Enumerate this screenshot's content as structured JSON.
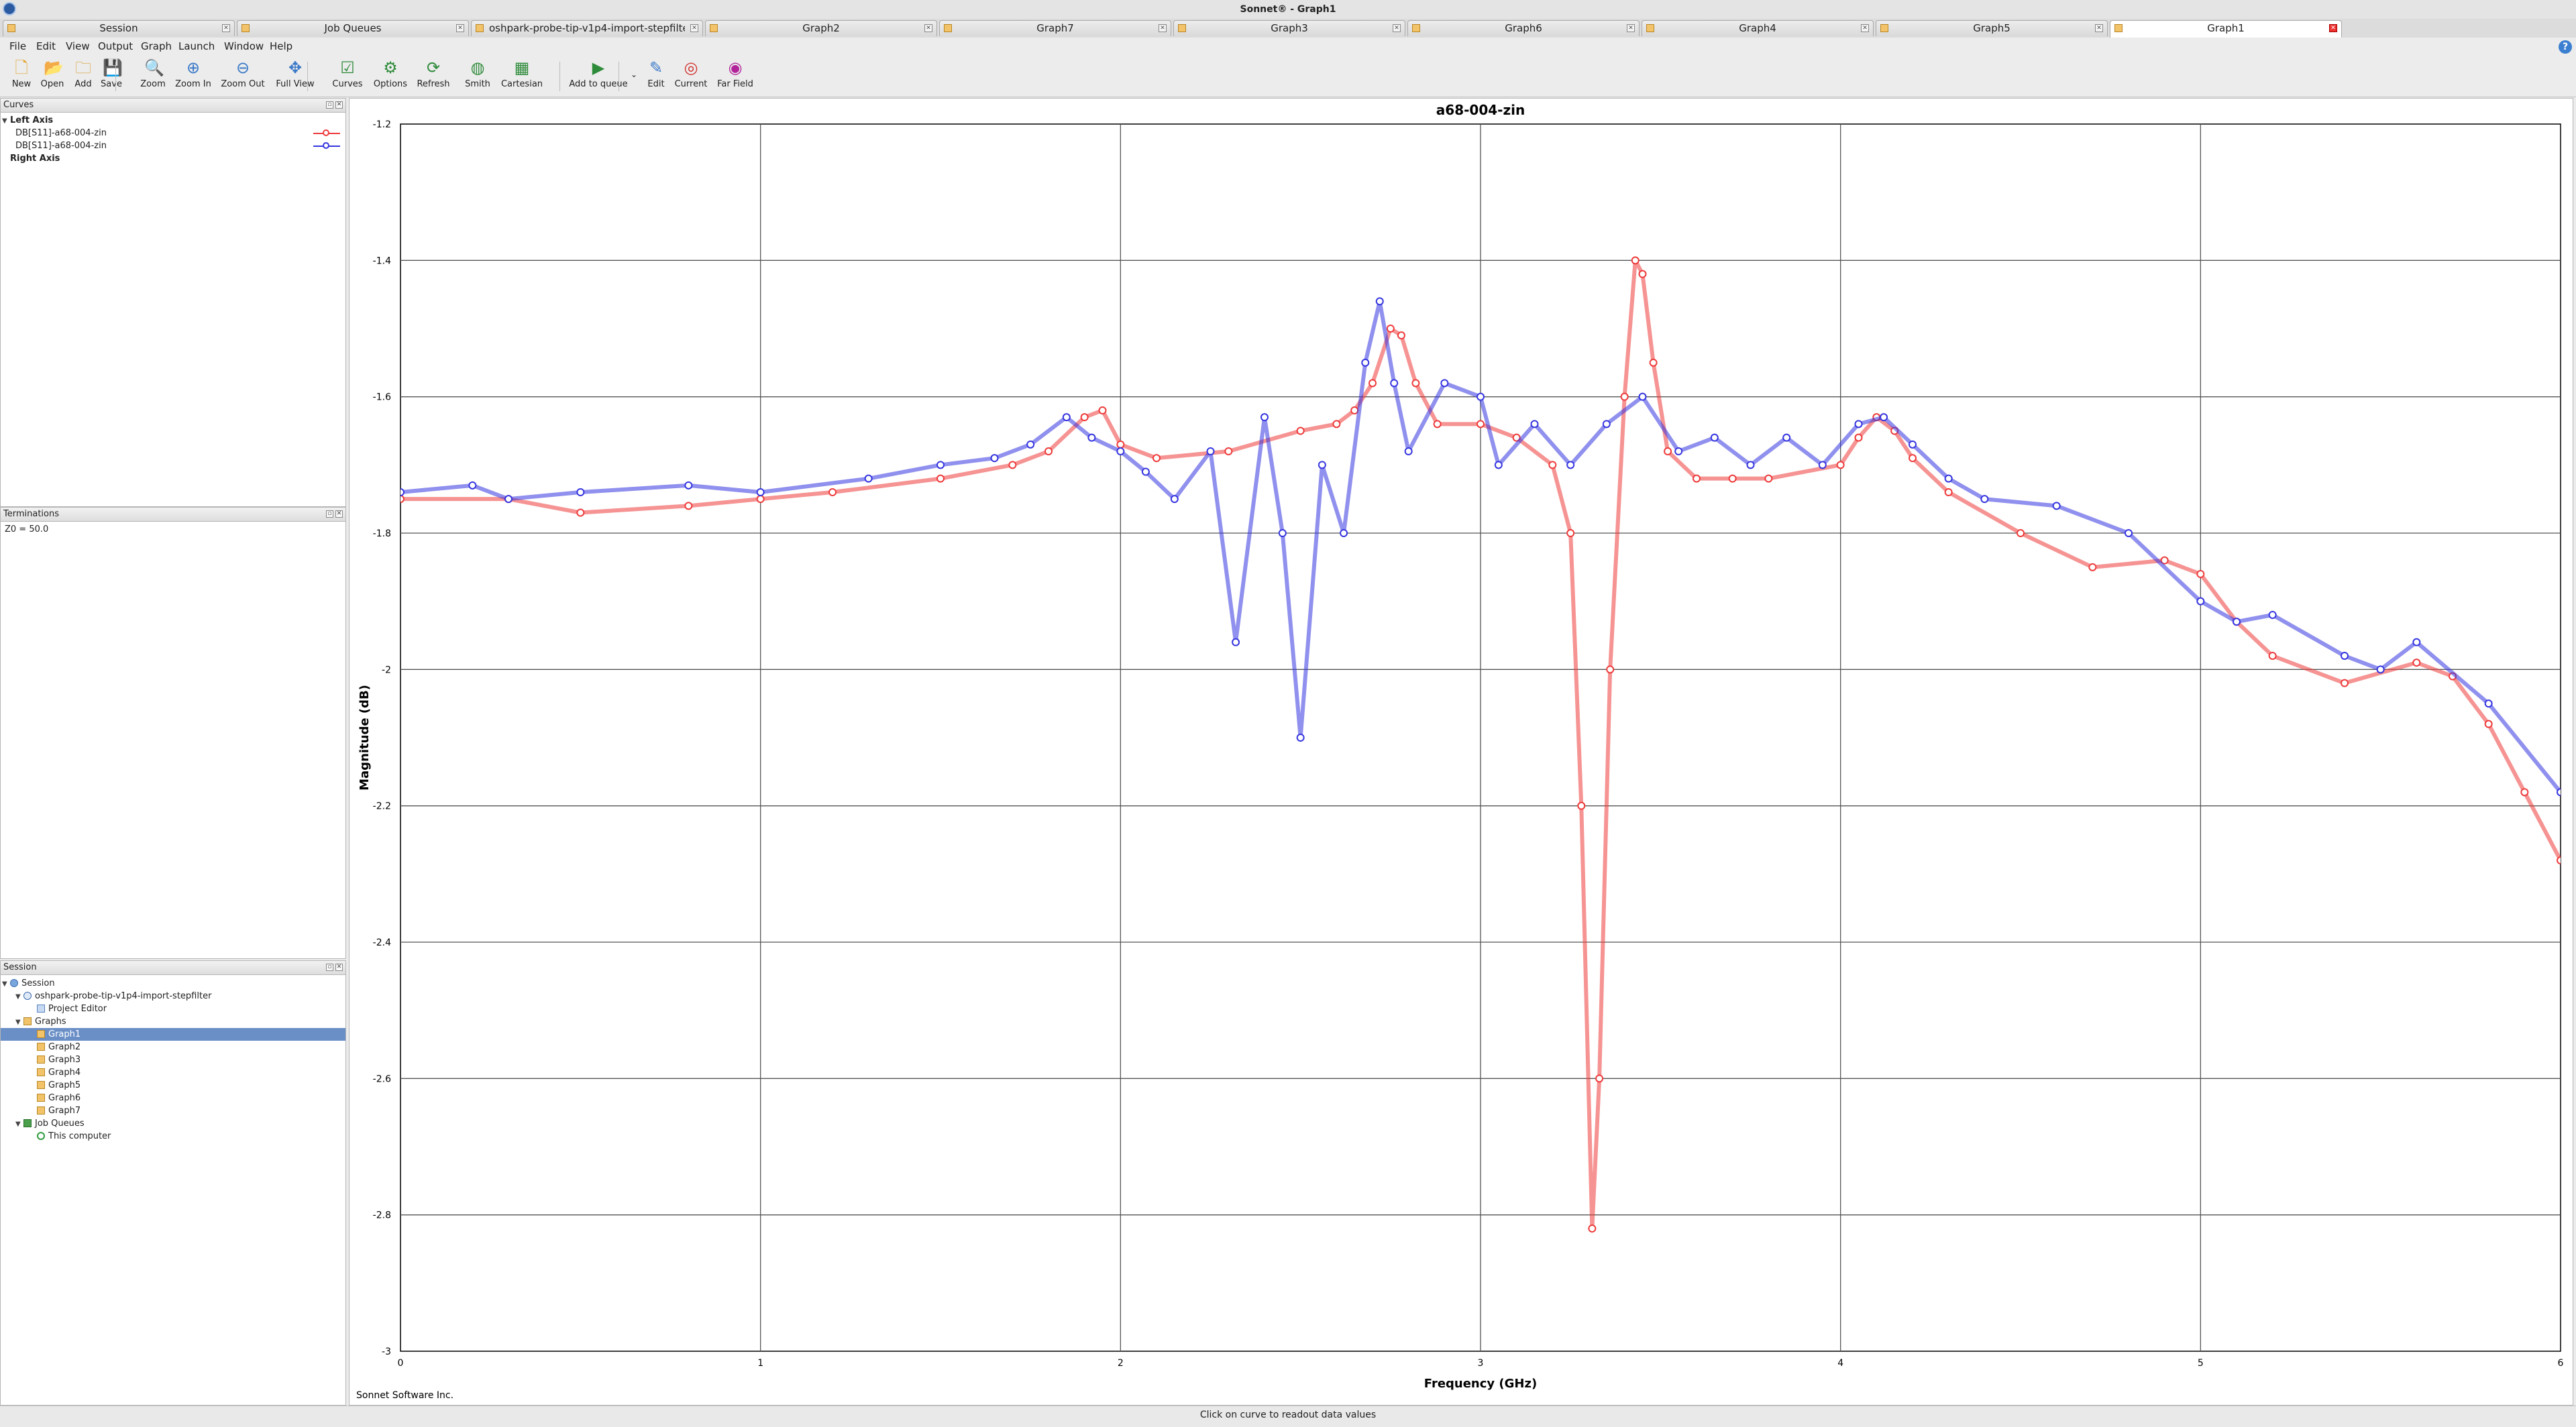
{
  "window": {
    "title": "Sonnet® - Graph1"
  },
  "tabs": [
    {
      "label": "Session",
      "icon": "session-icon"
    },
    {
      "label": "Job Queues",
      "icon": "queue-icon"
    },
    {
      "label": "oshpark-probe-tip-v1p4-import-stepfilter",
      "icon": "project-icon"
    },
    {
      "label": "Graph2",
      "icon": "graph-icon"
    },
    {
      "label": "Graph7",
      "icon": "graph-icon"
    },
    {
      "label": "Graph3",
      "icon": "graph-icon"
    },
    {
      "label": "Graph6",
      "icon": "graph-icon"
    },
    {
      "label": "Graph4",
      "icon": "graph-icon"
    },
    {
      "label": "Graph5",
      "icon": "graph-icon"
    },
    {
      "label": "Graph1",
      "icon": "graph-icon",
      "active": true
    }
  ],
  "menu": [
    "File",
    "Edit",
    "View",
    "Output",
    "Graph",
    "Launch",
    "Window",
    "Help"
  ],
  "toolbar": [
    {
      "label": "New",
      "icon": "new-file-icon",
      "glyph": "🗋",
      "color": "#e2a22c"
    },
    {
      "label": "Open",
      "icon": "open-folder-icon",
      "glyph": "📂",
      "color": "#d9a03a"
    },
    {
      "label": "Add",
      "icon": "add-folder-icon",
      "glyph": "🗀",
      "color": "#d9a03a"
    },
    {
      "label": "Save",
      "icon": "save-icon",
      "glyph": "💾",
      "color": "#d9a03a"
    },
    {
      "label": "Zoom",
      "icon": "zoom-icon",
      "glyph": "🔍",
      "color": "#3a78c8"
    },
    {
      "label": "Zoom In",
      "icon": "zoom-in-icon",
      "glyph": "⊕",
      "color": "#3a78c8"
    },
    {
      "label": "Zoom Out",
      "icon": "zoom-out-icon",
      "glyph": "⊖",
      "color": "#3a78c8"
    },
    {
      "label": "Full View",
      "icon": "full-view-icon",
      "glyph": "✥",
      "color": "#3a78c8"
    },
    {
      "label": "Curves",
      "icon": "curves-icon",
      "glyph": "☑",
      "color": "#2e8b3a"
    },
    {
      "label": "Options",
      "icon": "options-icon",
      "glyph": "⚙",
      "color": "#2e8b3a"
    },
    {
      "label": "Refresh",
      "icon": "refresh-icon",
      "glyph": "⟳",
      "color": "#2e8b3a"
    },
    {
      "label": "Smith",
      "icon": "smith-chart-icon",
      "glyph": "◍",
      "color": "#2e8b3a"
    },
    {
      "label": "Cartesian",
      "icon": "cartesian-icon",
      "glyph": "▦",
      "color": "#2e8b3a"
    },
    {
      "label": "Add to queue",
      "icon": "add-to-queue-icon",
      "glyph": "▶",
      "color": "#2e8b3a"
    },
    {
      "label": "Edit",
      "icon": "edit-icon",
      "glyph": "✎",
      "color": "#3a78c8"
    },
    {
      "label": "Current",
      "icon": "current-icon",
      "glyph": "◎",
      "color": "#d2312e"
    },
    {
      "label": "Far Field",
      "icon": "far-field-icon",
      "glyph": "◉",
      "color": "#b2259a"
    }
  ],
  "curves_panel": {
    "title": "Curves",
    "left_axis_label": "Left Axis",
    "right_axis_label": "Right Axis",
    "items": [
      {
        "label": "DB[S11]-a68-004-zin",
        "color": "#ee3a3a"
      },
      {
        "label": "DB[S11]-a68-004-zin",
        "color": "#3535e0"
      }
    ]
  },
  "terminations_panel": {
    "title": "Terminations",
    "text": "Z0 = 50.0"
  },
  "session_panel": {
    "title": "Session",
    "tree": [
      {
        "label": "Session",
        "level": 0,
        "icon": "session",
        "expanded": true
      },
      {
        "label": "oshpark-probe-tip-v1p4-import-stepfilter",
        "level": 1,
        "icon": "proj",
        "expanded": true
      },
      {
        "label": "Project Editor",
        "level": 2,
        "icon": "edit"
      },
      {
        "label": "Graphs",
        "level": 1,
        "icon": "folder",
        "expanded": true
      },
      {
        "label": "Graph1",
        "level": 2,
        "icon": "graph",
        "selected": true
      },
      {
        "label": "Graph2",
        "level": 2,
        "icon": "graph"
      },
      {
        "label": "Graph3",
        "level": 2,
        "icon": "graph"
      },
      {
        "label": "Graph4",
        "level": 2,
        "icon": "graph"
      },
      {
        "label": "Graph5",
        "level": 2,
        "icon": "graph"
      },
      {
        "label": "Graph6",
        "level": 2,
        "icon": "graph"
      },
      {
        "label": "Graph7",
        "level": 2,
        "icon": "graph"
      },
      {
        "label": "Job Queues",
        "level": 1,
        "icon": "queue",
        "expanded": true
      },
      {
        "label": "This computer",
        "level": 2,
        "icon": "check"
      }
    ]
  },
  "footer": {
    "company": "Sonnet Software Inc."
  },
  "status": {
    "text": "Click on curve to readout data values"
  },
  "chart_data": {
    "type": "scatter",
    "title": "a68-004-zin",
    "xlabel": "Frequency (GHz)",
    "ylabel": "Magnitude (dB)",
    "xlim": [
      0,
      6
    ],
    "ylim": [
      -3,
      -1.2
    ],
    "xticks": [
      0,
      1,
      2,
      3,
      4,
      5,
      6
    ],
    "yticks": [
      -3,
      -2.8,
      -2.6,
      -2.4,
      -2.2,
      -2,
      -1.8,
      -1.6,
      -1.4,
      -1.2
    ],
    "grid": true,
    "series": [
      {
        "color": "#ee3a3a",
        "x": [
          0,
          0.3,
          0.5,
          0.8,
          1.0,
          1.2,
          1.5,
          1.7,
          1.8,
          1.9,
          1.95,
          2.0,
          2.1,
          2.3,
          2.5,
          2.6,
          2.65,
          2.7,
          2.75,
          2.78,
          2.82,
          2.88,
          3.0,
          3.1,
          3.2,
          3.25,
          3.28,
          3.31,
          3.33,
          3.36,
          3.4,
          3.43,
          3.45,
          3.48,
          3.52,
          3.6,
          3.7,
          3.8,
          4.0,
          4.05,
          4.1,
          4.15,
          4.2,
          4.3,
          4.5,
          4.7,
          4.9,
          5.0,
          5.1,
          5.2,
          5.4,
          5.6,
          5.7,
          5.8,
          5.9,
          6.0
        ],
        "y": [
          -1.75,
          -1.75,
          -1.77,
          -1.76,
          -1.75,
          -1.74,
          -1.72,
          -1.7,
          -1.68,
          -1.63,
          -1.62,
          -1.67,
          -1.69,
          -1.68,
          -1.65,
          -1.64,
          -1.62,
          -1.58,
          -1.5,
          -1.51,
          -1.58,
          -1.64,
          -1.64,
          -1.66,
          -1.7,
          -1.8,
          -2.2,
          -2.82,
          -2.6,
          -2.0,
          -1.6,
          -1.4,
          -1.42,
          -1.55,
          -1.68,
          -1.72,
          -1.72,
          -1.72,
          -1.7,
          -1.66,
          -1.63,
          -1.65,
          -1.69,
          -1.74,
          -1.8,
          -1.85,
          -1.84,
          -1.86,
          -1.93,
          -1.98,
          -2.02,
          -1.99,
          -2.01,
          -2.08,
          -2.18,
          -2.28
        ]
      },
      {
        "color": "#3535e0",
        "x": [
          0,
          0.2,
          0.3,
          0.5,
          0.8,
          1.0,
          1.3,
          1.5,
          1.65,
          1.75,
          1.85,
          1.92,
          2.0,
          2.07,
          2.15,
          2.25,
          2.32,
          2.4,
          2.45,
          2.5,
          2.56,
          2.62,
          2.68,
          2.72,
          2.76,
          2.8,
          2.9,
          3.0,
          3.05,
          3.15,
          3.25,
          3.35,
          3.45,
          3.55,
          3.65,
          3.75,
          3.85,
          3.95,
          4.05,
          4.12,
          4.2,
          4.3,
          4.4,
          4.6,
          4.8,
          5.0,
          5.1,
          5.2,
          5.4,
          5.5,
          5.6,
          5.8,
          6.0
        ],
        "y": [
          -1.74,
          -1.73,
          -1.75,
          -1.74,
          -1.73,
          -1.74,
          -1.72,
          -1.7,
          -1.69,
          -1.67,
          -1.63,
          -1.66,
          -1.68,
          -1.71,
          -1.75,
          -1.68,
          -1.96,
          -1.63,
          -1.8,
          -2.1,
          -1.7,
          -1.8,
          -1.55,
          -1.46,
          -1.58,
          -1.68,
          -1.58,
          -1.6,
          -1.7,
          -1.64,
          -1.7,
          -1.64,
          -1.6,
          -1.68,
          -1.66,
          -1.7,
          -1.66,
          -1.7,
          -1.64,
          -1.63,
          -1.67,
          -1.72,
          -1.75,
          -1.76,
          -1.8,
          -1.9,
          -1.93,
          -1.92,
          -1.98,
          -2.0,
          -1.96,
          -2.05,
          -2.18
        ]
      }
    ]
  }
}
